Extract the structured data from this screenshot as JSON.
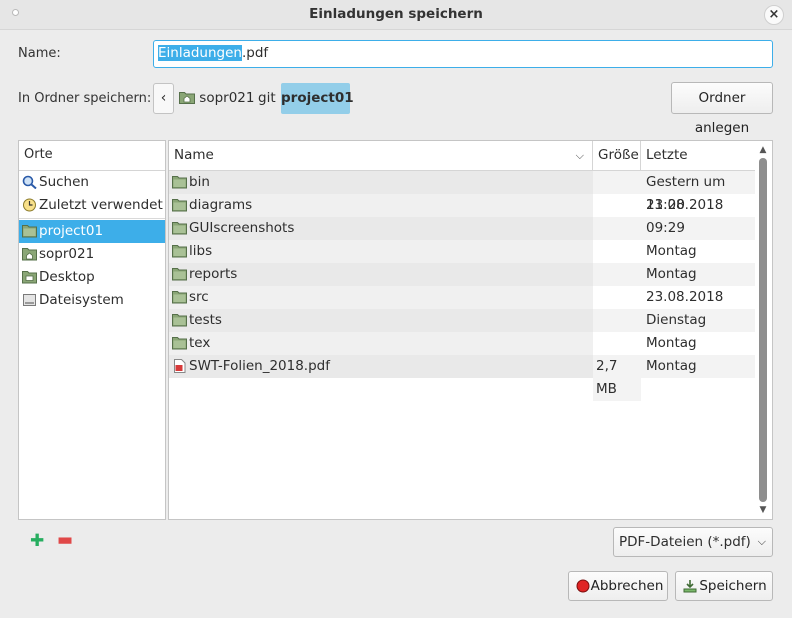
{
  "window": {
    "title": "Einladungen speichern"
  },
  "name_row": {
    "label": "Name:",
    "value_selected": "Einladungen",
    "value_rest": ".pdf"
  },
  "folder_row": {
    "label": "In Ordner speichern:",
    "breadcrumbs": [
      "sopr021",
      "git",
      "project01"
    ],
    "new_folder_button": "Ordner anlegen"
  },
  "places": {
    "header": "Orte",
    "items": [
      {
        "label": "Suchen",
        "icon": "search-icon"
      },
      {
        "label": "Zuletzt verwendet",
        "icon": "recent-icon"
      },
      {
        "label": "project01",
        "icon": "folder-icon",
        "selected": true
      },
      {
        "label": "sopr021",
        "icon": "home-folder-icon"
      },
      {
        "label": "Desktop",
        "icon": "desktop-folder-icon"
      },
      {
        "label": "Dateisystem",
        "icon": "drive-icon"
      }
    ]
  },
  "files": {
    "columns": [
      "Name",
      "Größe",
      "Letzte Änderung"
    ],
    "rows": [
      {
        "name": "bin",
        "size": "",
        "modified": "Gestern um 11:20",
        "icon": "folder-icon"
      },
      {
        "name": "diagrams",
        "size": "",
        "modified": "23.08.2018",
        "icon": "folder-icon"
      },
      {
        "name": "GUIscreenshots",
        "size": "",
        "modified": "09:29",
        "icon": "folder-icon"
      },
      {
        "name": "libs",
        "size": "",
        "modified": "Montag",
        "icon": "folder-icon"
      },
      {
        "name": "reports",
        "size": "",
        "modified": "Montag",
        "icon": "folder-icon"
      },
      {
        "name": "src",
        "size": "",
        "modified": "23.08.2018",
        "icon": "folder-icon"
      },
      {
        "name": "tests",
        "size": "",
        "modified": "Dienstag",
        "icon": "folder-icon"
      },
      {
        "name": "tex",
        "size": "",
        "modified": "Montag",
        "icon": "folder-icon"
      },
      {
        "name": "SWT-Folien_2018.pdf",
        "size": "2,7 MB",
        "modified": "Montag",
        "icon": "pdf-file-icon"
      }
    ]
  },
  "filter": {
    "selected": "PDF-Dateien (*.pdf)"
  },
  "buttons": {
    "cancel": "Abbrechen",
    "save": "Speichern"
  },
  "colors": {
    "accent": "#3daee9",
    "breadcrumb_active": "#93cee9",
    "folder": "#7f9c6e"
  }
}
